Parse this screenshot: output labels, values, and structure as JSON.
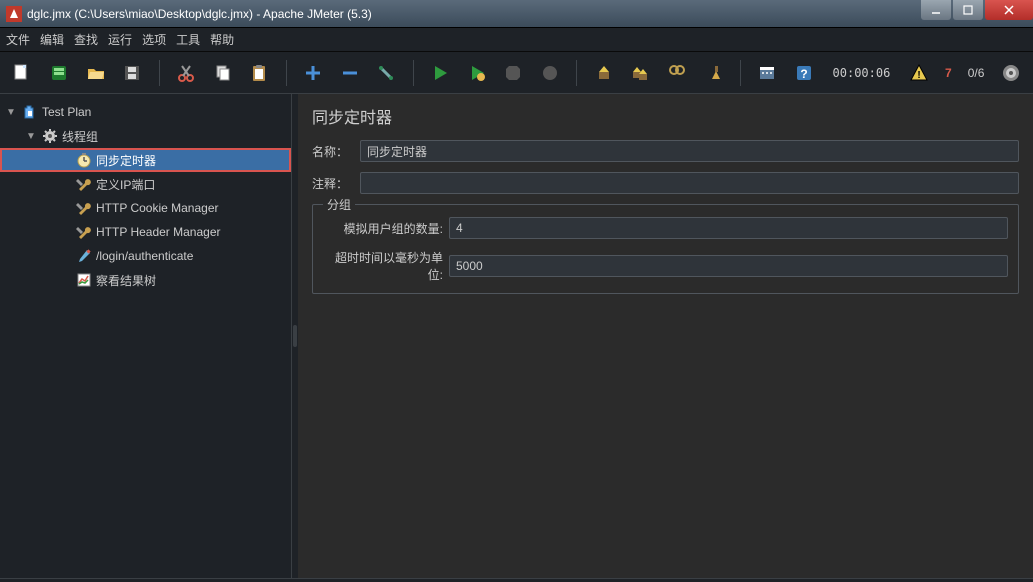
{
  "window": {
    "title": "dglc.jmx (C:\\Users\\miao\\Desktop\\dglc.jmx) - Apache JMeter (5.3)"
  },
  "menu": [
    "文件",
    "编辑",
    "查找",
    "运行",
    "选项",
    "工具",
    "帮助"
  ],
  "toolbar_status": {
    "time": "00:00:06",
    "warnings": "7",
    "threads": "0/6"
  },
  "tree": {
    "root": "Test Plan",
    "group": "线程组",
    "items": [
      {
        "label": "同步定时器",
        "icon": "timer",
        "selected": true,
        "highlighted": true
      },
      {
        "label": "定义IP端口",
        "icon": "wrench",
        "selected": false
      },
      {
        "label": "HTTP Cookie Manager",
        "icon": "wrench",
        "selected": false
      },
      {
        "label": "HTTP Header Manager",
        "icon": "wrench",
        "selected": false
      },
      {
        "label": "/login/authenticate",
        "icon": "sampler",
        "selected": false
      },
      {
        "label": "察看结果树",
        "icon": "chart",
        "selected": false
      }
    ]
  },
  "panel": {
    "title": "同步定时器",
    "name_label": "名称：",
    "name_value": "同步定时器",
    "comment_label": "注释：",
    "comment_value": "",
    "group_legend": "分组",
    "users_label": "模拟用户组的数量:",
    "users_value": "4",
    "timeout_label": "超时时间以毫秒为单位:",
    "timeout_value": "5000"
  }
}
